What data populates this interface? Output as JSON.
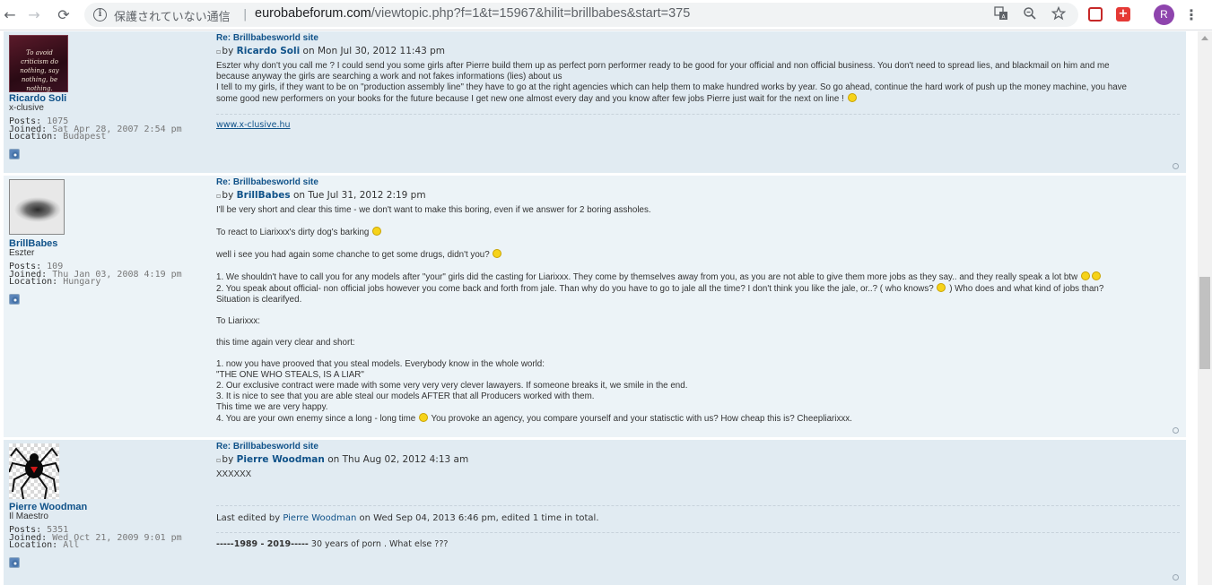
{
  "browser": {
    "back_icon": "←",
    "forward_icon": "→",
    "reload_icon": "⟳",
    "security_text": "保護されていない通信",
    "separator": "|",
    "url_host": "eurobabeforum.com",
    "url_path": "/viewtopic.php?f=1&t=15967&hilit=brillbabes&start=375",
    "profile_letter": "R",
    "ext2_symbol": "+"
  },
  "posts": [
    {
      "author": "Ricardo Soli",
      "rank": "x-clusive",
      "avatar_text": "To avoid criticism do nothing, say nothing, be nothing.",
      "posts_label": "Posts:",
      "posts_value": "1075",
      "joined_label": "Joined:",
      "joined_value": "Sat Apr 28, 2007 2:54 pm",
      "location_label": "Location:",
      "location_value": "Budapest",
      "title": "Re: Brillbabesworld site",
      "by": "by",
      "date": "on Mon Jul 30, 2012 11:43 pm",
      "lines": [
        "Eszter why don't you call me ? I could send you some girls after Pierre build them up as perfect porn performer ready to be good for your official and non official business. You don't need to spread lies, and blackmail on him and me",
        "because anyway the girls are searching a work and not fakes informations (lies) about us",
        "I tell to my girls, if they want to be on \"production assembly line\" they have to go at the right agencies which can help them to make hundred works by year. So go ahead, continue the hard work of push up the money machine, you have",
        "some good new performers on your books for the future because I get new one almost every day and you know after few jobs Pierre just wait for the next on line !"
      ],
      "signature_link": "www.x-clusive.hu"
    },
    {
      "author": "BrillBabes",
      "rank": "Eszter",
      "posts_label": "Posts:",
      "posts_value": "109",
      "joined_label": "Joined:",
      "joined_value": "Thu Jan 03, 2008 4:19 pm",
      "location_label": "Location:",
      "location_value": "Hungary",
      "title": "Re: Brillbabesworld site",
      "by": "by",
      "date": "on Tue Jul 31, 2012 2:19 pm",
      "lines": {
        "l1": "I'll be very short and clear this time - we don't want to make this boring, even if we answer for 2 boring assholes.",
        "l2": "To react to Liarixxx's dirty dog's barking",
        "l3": "well i see you had again some chanche to get some drugs, didn't you?",
        "l4": "1. We shouldn't have to call you for any models after \"your\" girls did the casting for Liarixxx. They come by themselves away from you, as you are not able to give them more jobs as they say.. and they really speak a lot btw",
        "l5a": "2. You speak about official- non official jobs however you come back and forth from jale. Than why do you have to go to jale all the time? I don't think you like the jale, or..? ( who knows?",
        "l5b": ") Who does and what kind of jobs than?",
        "l6": "Situation is clearifyed.",
        "l7": "To Liarixxx:",
        "l8": "this time again very clear and short:",
        "l9": "1. now you have prooved that you steal models. Everybody know in the whole world:",
        "l10": "\"THE ONE WHO STEALS, IS A LIAR\"",
        "l11": "2. Our exclusive contract were made with some very very very clever lawayers. If someone breaks it, we smile in the end.",
        "l12": "3. It is nice to see that you are able steal our models AFTER that all Producers worked with them.",
        "l13": "This time we are very happy.",
        "l14a": "4. You are your own enemy since a long - long time",
        "l14b": "You provoke an agency, you compare yourself and your statisctic with us? How cheap this is? Cheepliarixxx."
      }
    },
    {
      "author": "Pierre Woodman",
      "rank": "Il Maestro",
      "posts_label": "Posts:",
      "posts_value": "5351",
      "joined_label": "Joined:",
      "joined_value": "Wed Oct 21, 2009 9:01 pm",
      "location_label": "Location:",
      "location_value": "All",
      "title": "Re: Brillbabesworld site",
      "by": "by",
      "date": "on Thu Aug 02, 2012 4:13 am",
      "body": "XXXXXX",
      "edit_prefix": "Last edited by",
      "edit_author": "Pierre Woodman",
      "edit_suffix": "on Wed Sep 04, 2013 6:46 pm, edited 1 time in total.",
      "sig_bold": "-----1989 - 2019-----",
      "sig_rest": "30 years of porn . What else ???"
    }
  ]
}
